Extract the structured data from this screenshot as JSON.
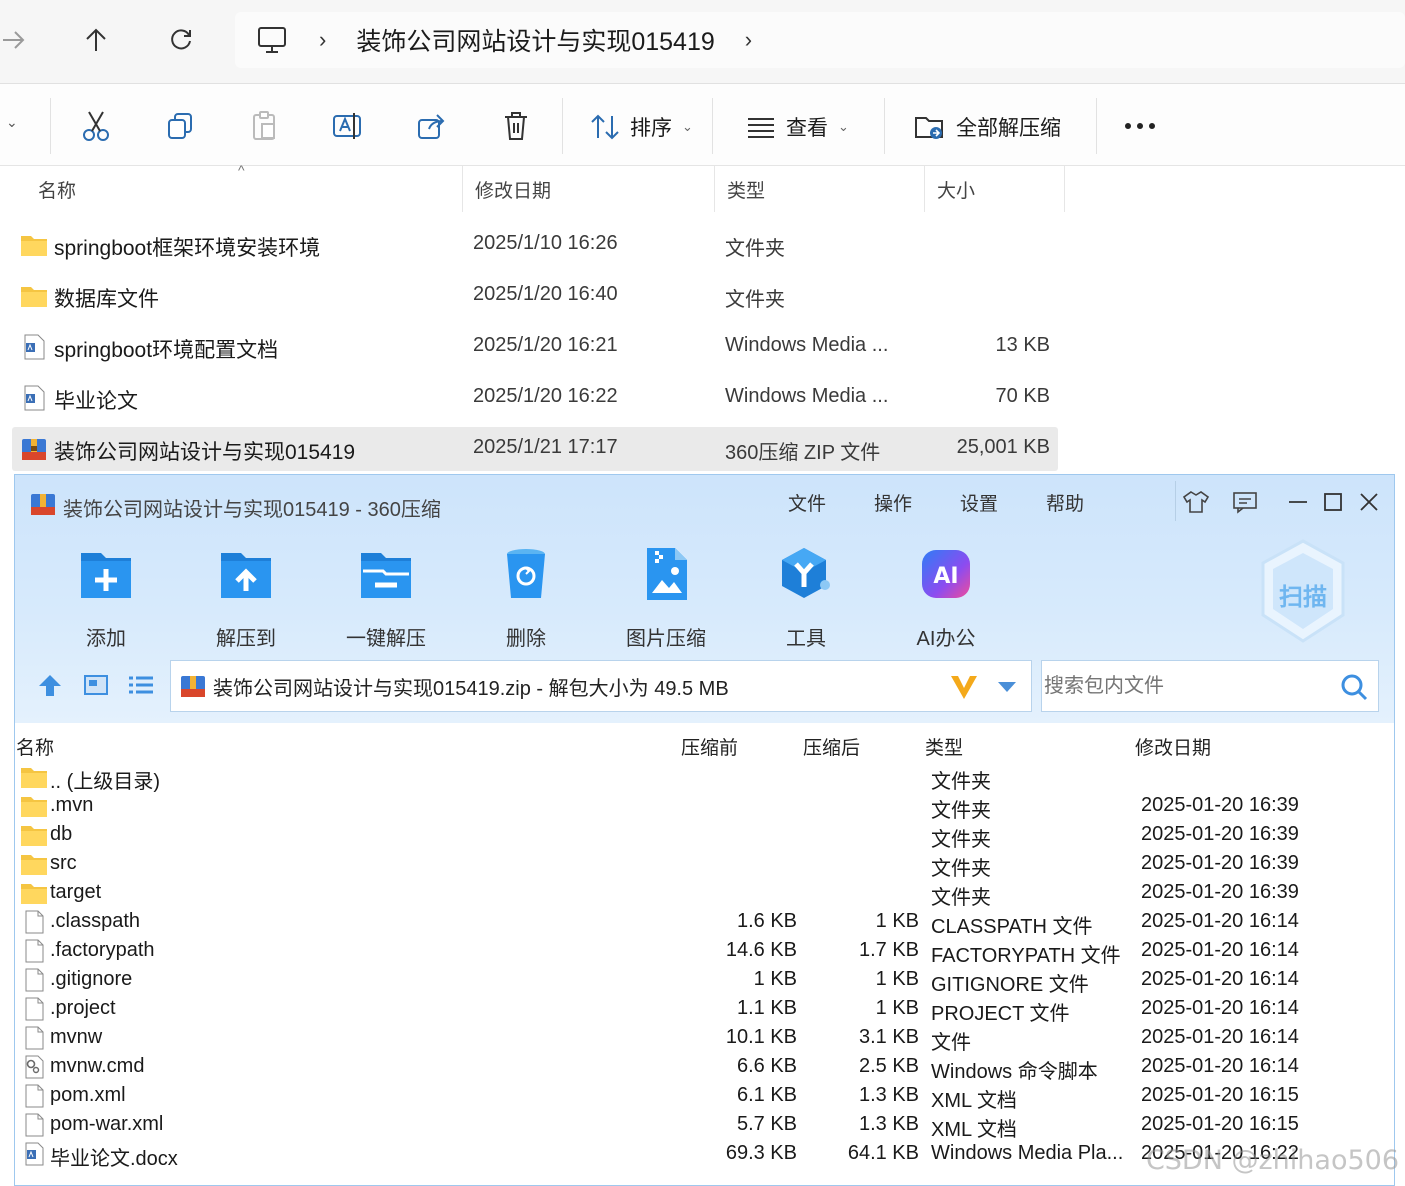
{
  "explorer": {
    "breadcrumb": "装饰公司网站设计与实现015419",
    "toolbar": {
      "sort_label": "排序",
      "view_label": "查看",
      "extract_all_label": "全部解压缩"
    },
    "columns": {
      "name": "名称",
      "date": "修改日期",
      "type": "类型",
      "size": "大小"
    },
    "files": [
      {
        "name": "springboot框架环境安装环境",
        "date": "2025/1/10 16:26",
        "type": "文件夹",
        "size": "",
        "icon": "folder-icon"
      },
      {
        "name": "数据库文件",
        "date": "2025/1/20 16:40",
        "type": "文件夹",
        "size": "",
        "icon": "folder-icon"
      },
      {
        "name": "springboot环境配置文档",
        "date": "2025/1/20 16:21",
        "type": "Windows Media ...",
        "size": "13 KB",
        "icon": "document-icon"
      },
      {
        "name": "毕业论文",
        "date": "2025/1/20 16:22",
        "type": "Windows Media ...",
        "size": "70 KB",
        "icon": "document-icon"
      },
      {
        "name": "装饰公司网站设计与实现015419",
        "date": "2025/1/21 17:17",
        "type": "360压缩 ZIP 文件",
        "size": "25,001 KB",
        "icon": "zip-icon"
      }
    ]
  },
  "zip360": {
    "title": "装饰公司网站设计与实现015419 - 360压缩",
    "menu": [
      "文件",
      "操作",
      "设置",
      "帮助"
    ],
    "buttons": [
      "添加",
      "解压到",
      "一键解压",
      "删除",
      "图片压缩",
      "工具",
      "AI办公"
    ],
    "scan_label": "扫描",
    "path": "装饰公司网站设计与实现015419.zip - 解包大小为 49.5 MB",
    "search_placeholder": "搜索包内文件",
    "columns": {
      "name": "名称",
      "before": "压缩前",
      "after": "压缩后",
      "type": "类型",
      "date": "修改日期"
    },
    "rows": [
      {
        "name": ".. (上级目录)",
        "before": "",
        "after": "",
        "type": "文件夹",
        "date": "",
        "icon": "folder"
      },
      {
        "name": ".mvn",
        "before": "",
        "after": "",
        "type": "文件夹",
        "date": "2025-01-20 16:39",
        "icon": "folder"
      },
      {
        "name": "db",
        "before": "",
        "after": "",
        "type": "文件夹",
        "date": "2025-01-20 16:39",
        "icon": "folder"
      },
      {
        "name": "src",
        "before": "",
        "after": "",
        "type": "文件夹",
        "date": "2025-01-20 16:39",
        "icon": "folder"
      },
      {
        "name": "target",
        "before": "",
        "after": "",
        "type": "文件夹",
        "date": "2025-01-20 16:39",
        "icon": "folder"
      },
      {
        "name": ".classpath",
        "before": "1.6 KB",
        "after": "1 KB",
        "type": "CLASSPATH 文件",
        "date": "2025-01-20 16:14",
        "icon": "file"
      },
      {
        "name": ".factorypath",
        "before": "14.6 KB",
        "after": "1.7 KB",
        "type": "FACTORYPATH 文件",
        "date": "2025-01-20 16:14",
        "icon": "file"
      },
      {
        "name": ".gitignore",
        "before": "1 KB",
        "after": "1 KB",
        "type": "GITIGNORE 文件",
        "date": "2025-01-20 16:14",
        "icon": "file"
      },
      {
        "name": ".project",
        "before": "1.1 KB",
        "after": "1 KB",
        "type": "PROJECT 文件",
        "date": "2025-01-20 16:14",
        "icon": "file"
      },
      {
        "name": "mvnw",
        "before": "10.1 KB",
        "after": "3.1 KB",
        "type": "文件",
        "date": "2025-01-20 16:14",
        "icon": "file"
      },
      {
        "name": "mvnw.cmd",
        "before": "6.6 KB",
        "after": "2.5 KB",
        "type": "Windows 命令脚本",
        "date": "2025-01-20 16:14",
        "icon": "cmd"
      },
      {
        "name": "pom.xml",
        "before": "6.1 KB",
        "after": "1.3 KB",
        "type": "XML 文档",
        "date": "2025-01-20 16:15",
        "icon": "file"
      },
      {
        "name": "pom-war.xml",
        "before": "5.7 KB",
        "after": "1.3 KB",
        "type": "XML 文档",
        "date": "2025-01-20 16:15",
        "icon": "file"
      },
      {
        "name": "毕业论文.docx",
        "before": "69.3 KB",
        "after": "64.1 KB",
        "type": "Windows Media Pla...",
        "date": "2025-01-20 16:22",
        "icon": "doc"
      }
    ]
  },
  "watermark": "CSDN @zhihao506"
}
